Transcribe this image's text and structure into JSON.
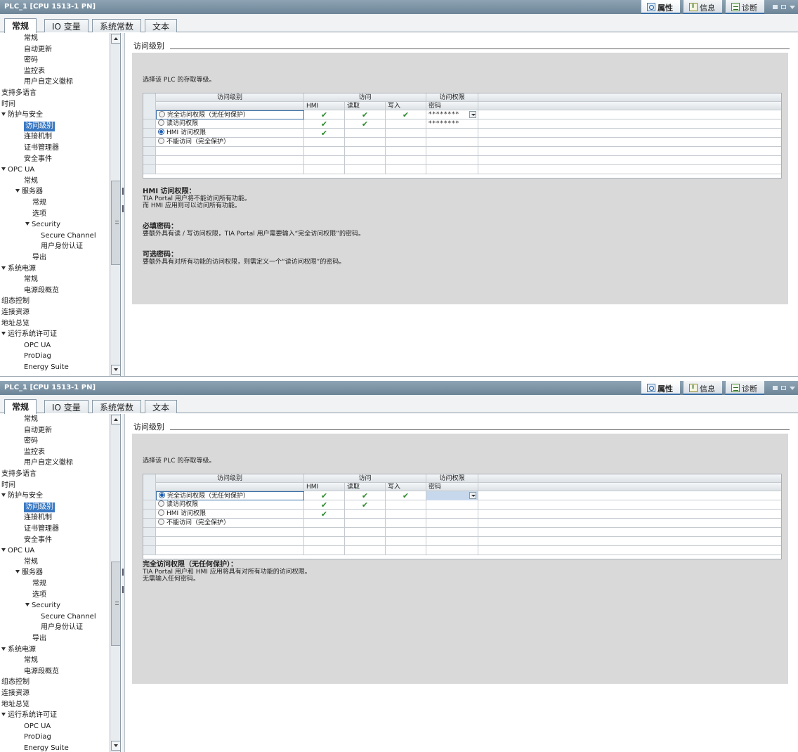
{
  "panels": [
    {
      "title": "PLC_1 [CPU 1513-1 PN]",
      "right_tabs": [
        "属性",
        "信息",
        "诊断"
      ],
      "tabs": [
        "常规",
        "IO 变量",
        "系统常数",
        "文本"
      ],
      "nav": [
        "常规",
        "自动更新",
        "密码",
        "监控表",
        "用户自定义徽标",
        "支持多语言",
        "时间",
        "防护与安全",
        "访问级别",
        "连接机制",
        "证书管理器",
        "安全事件",
        "OPC UA",
        "常规",
        "服务器",
        "常规",
        "选项",
        "Security",
        "Secure Channel",
        "用户身份认证",
        "导出",
        "系统电源",
        "常规",
        "电源段概览",
        "组态控制",
        "连接资源",
        "地址总览",
        "运行系统许可证",
        "OPC UA",
        "ProDiag",
        "Energy Suite"
      ],
      "section_title": "访问级别",
      "description": "选择该 PLC 的存取等级。",
      "header1": [
        "访问级别",
        "访问",
        "访问权限"
      ],
      "header2": [
        "HMI",
        "读取",
        "写入",
        "密码"
      ],
      "rows": [
        {
          "label": "完全访问权限（无任何保护）",
          "hmi": true,
          "read": true,
          "write": true,
          "password": "********",
          "selected": false
        },
        {
          "label": "读访问权限",
          "hmi": true,
          "read": true,
          "write": false,
          "password": "********",
          "selected": false
        },
        {
          "label": "HMI 访问权限",
          "hmi": true,
          "read": false,
          "write": false,
          "password": "",
          "selected": true
        },
        {
          "label": "不能访问（完全保护）",
          "hmi": false,
          "read": false,
          "write": false,
          "password": "",
          "selected": false
        }
      ],
      "info": [
        {
          "heading": "HMI 访问权限：",
          "lines": [
            "TIA Portal 用户将不能访问所有功能。",
            "而 HMI 应用则可以访问所有功能。"
          ]
        },
        {
          "heading": "必填密码：",
          "lines": [
            "要额外具有读 / 写访问权限，TIA Portal 用户需要输入“完全访问权限”的密码。"
          ]
        },
        {
          "heading": "可选密码：",
          "lines": [
            "要额外具有对所有功能的访问权限，则需定义一个“读访问权限”的密码。"
          ]
        }
      ]
    },
    {
      "title": "PLC_1 [CPU 1513-1 PN]",
      "right_tabs": [
        "属性",
        "信息",
        "诊断"
      ],
      "tabs": [
        "常规",
        "IO 变量",
        "系统常数",
        "文本"
      ],
      "nav": [
        "常规",
        "自动更新",
        "密码",
        "监控表",
        "用户自定义徽标",
        "支持多语言",
        "时间",
        "防护与安全",
        "访问级别",
        "连接机制",
        "证书管理器",
        "安全事件",
        "OPC UA",
        "常规",
        "服务器",
        "常规",
        "选项",
        "Security",
        "Secure Channel",
        "用户身份认证",
        "导出",
        "系统电源",
        "常规",
        "电源段概览",
        "组态控制",
        "连接资源",
        "地址总览",
        "运行系统许可证",
        "OPC UA",
        "ProDiag",
        "Energy Suite"
      ],
      "section_title": "访问级别",
      "description": "选择该 PLC 的存取等级。",
      "header1": [
        "访问级别",
        "访问",
        "访问权限"
      ],
      "header2": [
        "HMI",
        "读取",
        "写入",
        "密码"
      ],
      "rows": [
        {
          "label": "完全访问权限（无任何保护）",
          "hmi": true,
          "read": true,
          "write": true,
          "password": "",
          "selected": true
        },
        {
          "label": "读访问权限",
          "hmi": true,
          "read": true,
          "write": false,
          "password": "",
          "selected": false
        },
        {
          "label": "HMI 访问权限",
          "hmi": true,
          "read": false,
          "write": false,
          "password": "",
          "selected": false
        },
        {
          "label": "不能访问（完全保护）",
          "hmi": false,
          "read": false,
          "write": false,
          "password": "",
          "selected": false
        }
      ],
      "info": [
        {
          "heading": "完全访问权限（无任何保护）：",
          "lines": [
            "TIA Portal 用户和 HMI 应用将具有对所有功能的访问权限。",
            "无需输入任何密码。"
          ]
        }
      ]
    }
  ],
  "check_glyph": "✔",
  "icons": {
    "properties": "magnifier-icon",
    "info": "info-icon",
    "diagnostics": "diagnostics-icon"
  },
  "colors": {
    "accent": "#3a78c2",
    "check": "#2a8a2a",
    "panel_grey": "#d9d9d9",
    "titlebar": "#7b91a3"
  }
}
